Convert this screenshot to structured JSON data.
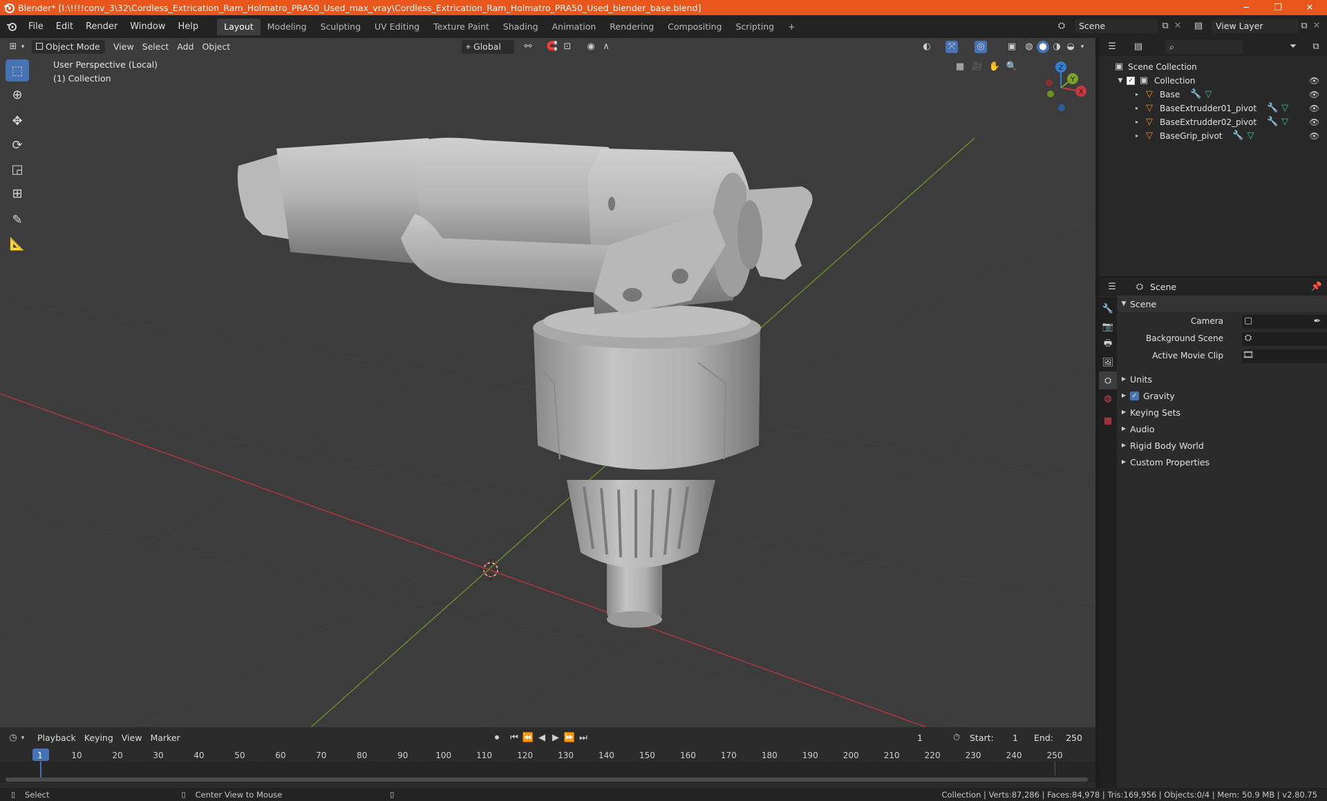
{
  "window": {
    "title": "Blender* [I:\\!!!!conv_3\\32\\Cordless_Extrication_Ram_Holmatro_PRA50_Used_max_vray\\Cordless_Extrication_Ram_Holmatro_PRA50_Used_blender_base.blend]",
    "minimize": "─",
    "restore": "❐",
    "close": "✕"
  },
  "menu": [
    "File",
    "Edit",
    "Render",
    "Window",
    "Help"
  ],
  "workspaces": [
    "Layout",
    "Modeling",
    "Sculpting",
    "UV Editing",
    "Texture Paint",
    "Shading",
    "Animation",
    "Rendering",
    "Compositing",
    "Scripting"
  ],
  "add_workspace": "+",
  "scene_field": "Scene",
  "view_layer_field": "View Layer",
  "viewport": {
    "mode": "Object Mode",
    "menus": [
      "View",
      "Select",
      "Add",
      "Object"
    ],
    "transform_orientation": "Global",
    "perspective_label": "User Perspective (Local)",
    "collection_label": "(1) Collection",
    "gizmo": {
      "x": "X",
      "y": "Y",
      "z": "Z"
    }
  },
  "outliner": {
    "root": "Scene Collection",
    "collection": "Collection",
    "items": [
      "Base",
      "BaseExtrudder01_pivot",
      "BaseExtrudder02_pivot",
      "BaseGrip_pivot"
    ]
  },
  "properties": {
    "header": "Scene",
    "section": "Scene",
    "fields": [
      {
        "label": "Camera"
      },
      {
        "label": "Background Scene"
      },
      {
        "label": "Active Movie Clip"
      }
    ],
    "panels": [
      "Units",
      "Gravity",
      "Keying Sets",
      "Audio",
      "Rigid Body World",
      "Custom Properties"
    ]
  },
  "timeline": {
    "menus": [
      "Playback",
      "Keying",
      "View",
      "Marker"
    ],
    "current_frame": "1",
    "start_label": "Start:",
    "start": "1",
    "end_label": "End:",
    "end": "250",
    "ticks": [
      "1",
      "10",
      "20",
      "30",
      "40",
      "50",
      "60",
      "70",
      "80",
      "90",
      "100",
      "110",
      "120",
      "130",
      "140",
      "150",
      "160",
      "170",
      "180",
      "190",
      "200",
      "210",
      "220",
      "230",
      "240",
      "250"
    ]
  },
  "status": {
    "left_action": "Select",
    "middle_action": "Center View to Mouse",
    "stats": "Collection | Verts:87,286 | Faces:84,978 | Tris:169,956 | Objects:0/4 | Mem: 50.9 MB | v2.80.75"
  },
  "colors": {
    "titlebar": "#e8561c",
    "accent": "#4772b3",
    "x_axis": "#c7383e",
    "y_axis": "#7ea12a",
    "z_axis": "#2f7fd6",
    "object_icon": "#e8912c",
    "modifier_icon": "#6aa1ef",
    "mesh_icon": "#32c8a0"
  }
}
